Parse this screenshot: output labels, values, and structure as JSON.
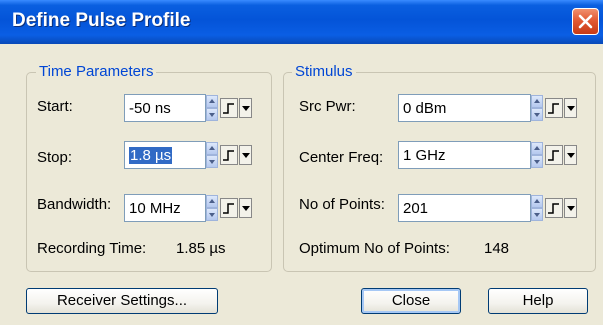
{
  "window": {
    "title": "Define Pulse Profile"
  },
  "time_parameters": {
    "legend": "Time Parameters",
    "start": {
      "label": "Start:",
      "value": "-50 ns"
    },
    "stop": {
      "label": "Stop:",
      "value": "1.8 µs"
    },
    "bandwidth": {
      "label": "Bandwidth:",
      "value": "10 MHz"
    },
    "recording_time": {
      "label": "Recording Time:",
      "value": "1.85 µs"
    }
  },
  "stimulus": {
    "legend": "Stimulus",
    "src_pwr": {
      "label": "Src Pwr:",
      "value": "0 dBm"
    },
    "center_freq": {
      "label": "Center Freq:",
      "value": "1 GHz"
    },
    "no_of_points": {
      "label": "No of Points:",
      "value": "201"
    },
    "optimum_points": {
      "label": "Optimum No of Points:",
      "value": "148"
    }
  },
  "buttons": {
    "receiver_settings": "Receiver Settings...",
    "close": "Close",
    "help": "Help"
  },
  "icons": {
    "window_close": "close-x-icon",
    "spinner": "spin-updown-icon",
    "step": "step-size-icon",
    "dropdown": "dropdown-arrow-icon"
  },
  "colors": {
    "titlebar": "#0454d8",
    "close_button": "#e25a34",
    "group_legend": "#0046d5",
    "selection": "#316ac5",
    "dialog_bg": "#ece9d8"
  }
}
